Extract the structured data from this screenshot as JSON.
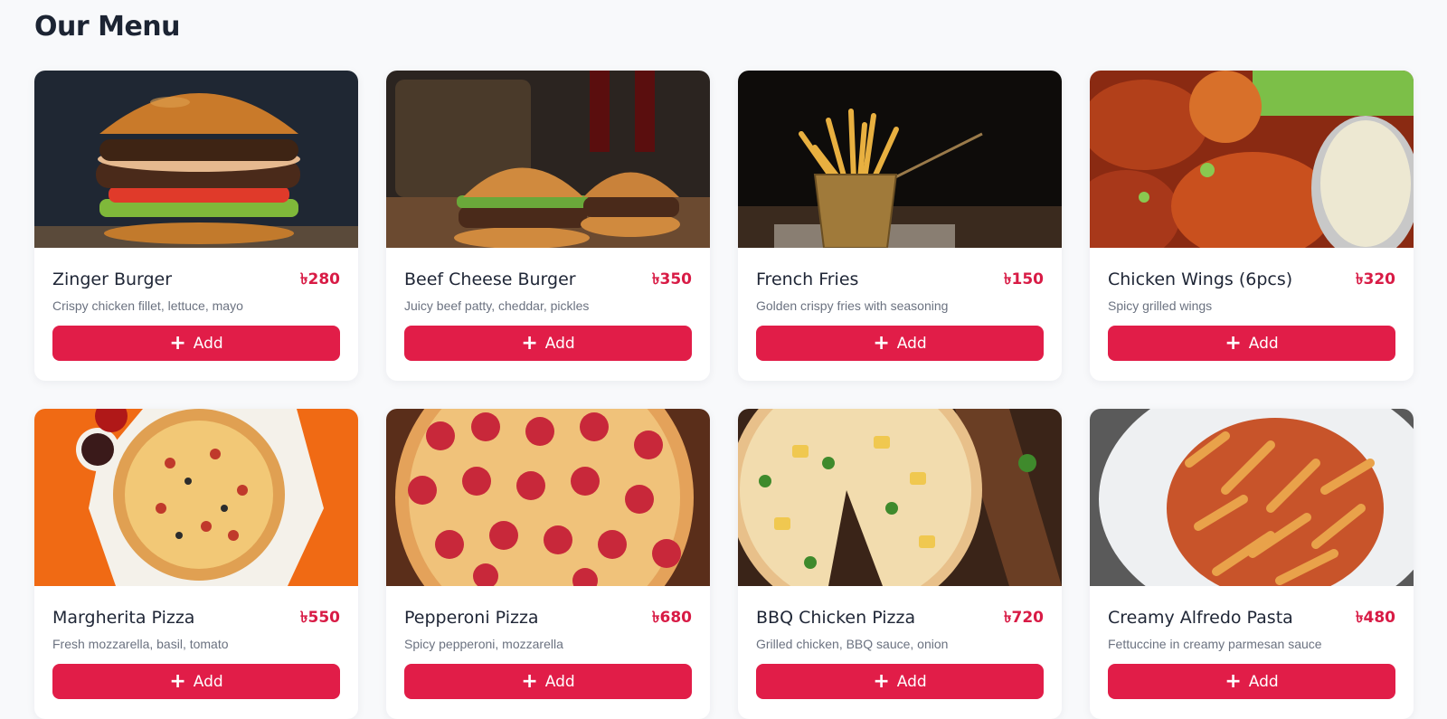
{
  "page": {
    "title": "Our Menu"
  },
  "currency_symbol": "৳",
  "accent_color": "#e11d48",
  "price_color": "#d81b45",
  "items": [
    {
      "name": "Zinger Burger",
      "price": "৳280",
      "description": "Crispy chicken fillet, lettuce, mayo",
      "button_label": "Add",
      "image": "burger-photo"
    },
    {
      "name": "Beef Cheese Burger",
      "price": "৳350",
      "description": "Juicy beef patty, cheddar, pickles",
      "button_label": "Add",
      "image": "burger-pair-photo"
    },
    {
      "name": "French Fries",
      "price": "৳150",
      "description": "Golden crispy fries with seasoning",
      "button_label": "Add",
      "image": "fries-photo"
    },
    {
      "name": "Chicken Wings (6pcs)",
      "price": "৳320",
      "description": "Spicy grilled wings",
      "button_label": "Add",
      "image": "wings-photo"
    },
    {
      "name": "Margherita Pizza",
      "price": "৳550",
      "description": "Fresh mozzarella, basil, tomato",
      "button_label": "Add",
      "image": "margherita-photo"
    },
    {
      "name": "Pepperoni Pizza",
      "price": "৳680",
      "description": "Spicy pepperoni, mozzarella",
      "button_label": "Add",
      "image": "pepperoni-photo"
    },
    {
      "name": "BBQ Chicken Pizza",
      "price": "৳720",
      "description": "Grilled chicken, BBQ sauce, onion",
      "button_label": "Add",
      "image": "bbq-pizza-photo"
    },
    {
      "name": "Creamy Alfredo Pasta",
      "price": "৳480",
      "description": "Fettuccine in creamy parmesan sauce",
      "button_label": "Add",
      "image": "pasta-photo"
    }
  ]
}
